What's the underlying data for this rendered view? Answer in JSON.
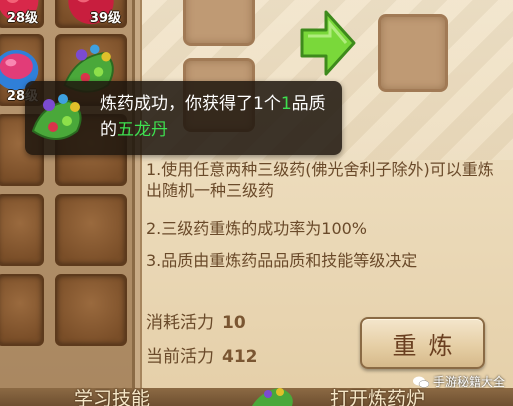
{
  "inventory": {
    "slots": [
      {
        "count": "28级",
        "item": "red-orb-item"
      },
      {
        "count": "39级",
        "item": "red-orb-item"
      },
      {
        "count": "28级",
        "item": "purple-bowl-item"
      },
      {
        "count": "",
        "item": "five-dragon-pill-item"
      },
      {
        "count": "",
        "item": "empty"
      },
      {
        "count": "",
        "item": "empty"
      },
      {
        "count": "",
        "item": "empty"
      },
      {
        "count": "",
        "item": "empty"
      },
      {
        "count": "",
        "item": "empty"
      },
      {
        "count": "",
        "item": "empty"
      }
    ]
  },
  "refine": {
    "instructions": [
      "1.使用任意两种三级药(佛光舍利子除外)可以重炼出随机一种三级药",
      "2.三级药重炼的成功率为100%",
      "3.品质由重炼药品品质和技能等级决定"
    ],
    "cost_label": "消耗活力",
    "cost_value": "10",
    "current_label": "当前活力",
    "current_value": "412",
    "button_label": "重炼"
  },
  "toast": {
    "prefix": "炼药成功，你获得了1个",
    "quality": "1",
    "middle": "品质的",
    "item_name": "五龙丹"
  },
  "bottom_tabs": [
    "学习技能",
    "打开炼药炉"
  ],
  "watermark": "手游秘籍大全",
  "colors": {
    "accent_green": "#3ee050",
    "panel_bg": "#f1e3c8",
    "text_brown": "#6a4a2a"
  }
}
